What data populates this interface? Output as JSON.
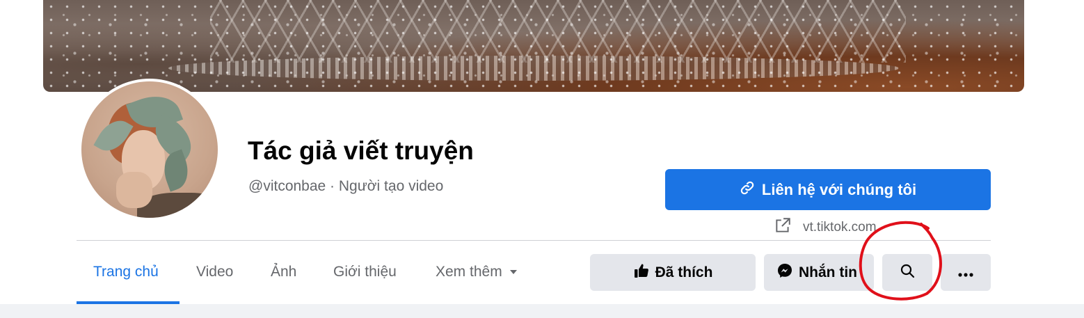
{
  "page": {
    "name": "Tác giả viết truyện",
    "subtitle": "@vitconbae · Người tạo video"
  },
  "contact_button": {
    "label": "Liên hệ với chúng tôi",
    "icon": "link-icon"
  },
  "website": {
    "url": "vt.tiktok.com",
    "icon": "external-link-icon"
  },
  "tabs": [
    {
      "label": "Trang chủ",
      "active": true
    },
    {
      "label": "Video",
      "active": false
    },
    {
      "label": "Ảnh",
      "active": false
    },
    {
      "label": "Giới thiệu",
      "active": false
    },
    {
      "label": "Xem thêm",
      "active": false,
      "icon": "caret-down-icon"
    }
  ],
  "actions": {
    "like": {
      "label": "Đã thích",
      "icon": "thumbs-up-icon"
    },
    "message": {
      "label": "Nhắn tin",
      "icon": "messenger-icon"
    },
    "search": {
      "icon": "search-icon"
    },
    "more": {
      "icon": "more-icon"
    }
  },
  "colors": {
    "accent": "#1b74e4",
    "secondary_button": "#e4e6eb",
    "muted_text": "#65676b",
    "annotation": "#e0101a"
  }
}
